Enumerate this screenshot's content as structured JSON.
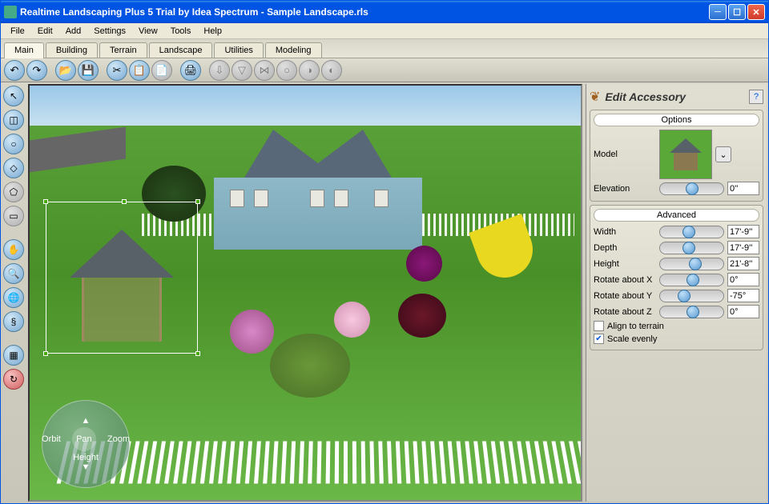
{
  "title": "Realtime Landscaping Plus 5 Trial by Idea Spectrum - Sample Landscape.rls",
  "menus": [
    "File",
    "Edit",
    "Add",
    "Settings",
    "View",
    "Tools",
    "Help"
  ],
  "tabs": [
    "Main",
    "Building",
    "Terrain",
    "Landscape",
    "Utilities",
    "Modeling"
  ],
  "active_tab": "Main",
  "nav": {
    "orbit": "Orbit",
    "zoom": "Zoom",
    "pan": "Pan",
    "height": "Height"
  },
  "panel": {
    "title": "Edit Accessory",
    "help": "?",
    "options_head": "Options",
    "advanced_head": "Advanced",
    "model_label": "Model",
    "elevation": {
      "label": "Elevation",
      "value": "0''"
    },
    "width": {
      "label": "Width",
      "value": "17'-9''"
    },
    "depth": {
      "label": "Depth",
      "value": "17'-9''"
    },
    "height": {
      "label": "Height",
      "value": "21'-8''"
    },
    "rotx": {
      "label": "Rotate about X",
      "value": "0°"
    },
    "roty": {
      "label": "Rotate about Y",
      "value": "-75°"
    },
    "rotz": {
      "label": "Rotate about Z",
      "value": "0°"
    },
    "align": {
      "label": "Align to terrain",
      "checked": false
    },
    "scale": {
      "label": "Scale evenly",
      "checked": true
    }
  }
}
